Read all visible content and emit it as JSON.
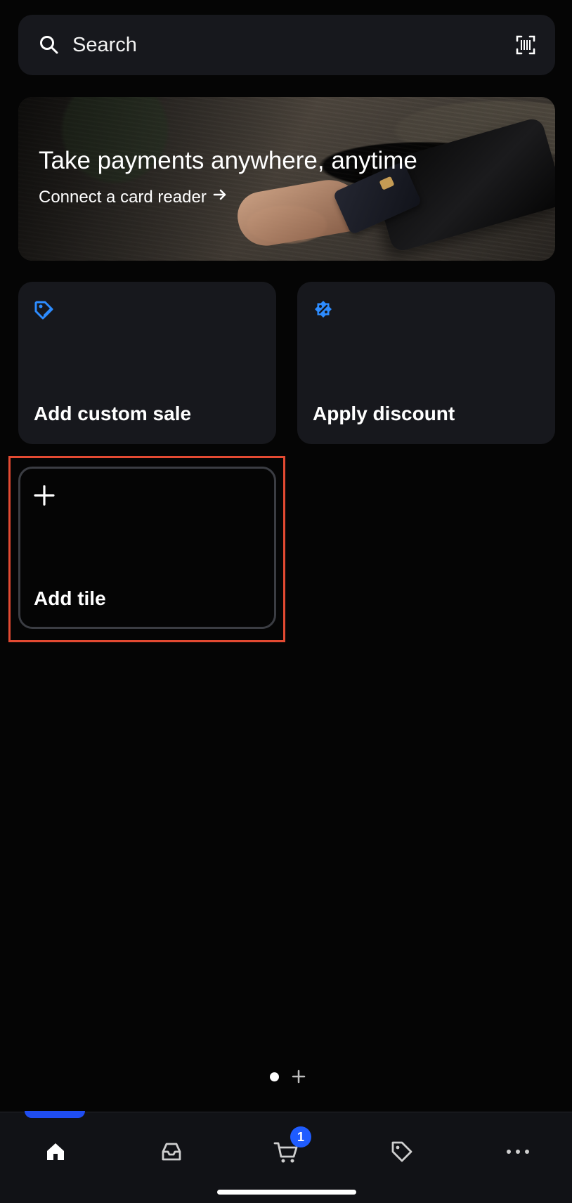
{
  "search": {
    "label": "Search"
  },
  "banner": {
    "title": "Take payments anywhere, anytime",
    "link_text": "Connect a card reader"
  },
  "tiles": [
    {
      "label": "Add custom sale",
      "icon": "tag-edit-icon",
      "accent": "#2d8cff"
    },
    {
      "label": "Apply discount",
      "icon": "discount-badge-icon",
      "accent": "#2d8cff"
    },
    {
      "label": "Add tile",
      "icon": "plus-icon",
      "accent": "#ffffff"
    }
  ],
  "pager": {
    "current": "page-dot",
    "add": "plus-icon"
  },
  "bottom_nav": {
    "cart_badge": "1",
    "active_item": "home",
    "active_color": "#1f4df1"
  },
  "selection": {
    "outline_color": "#e34a32",
    "target": "Add tile"
  }
}
